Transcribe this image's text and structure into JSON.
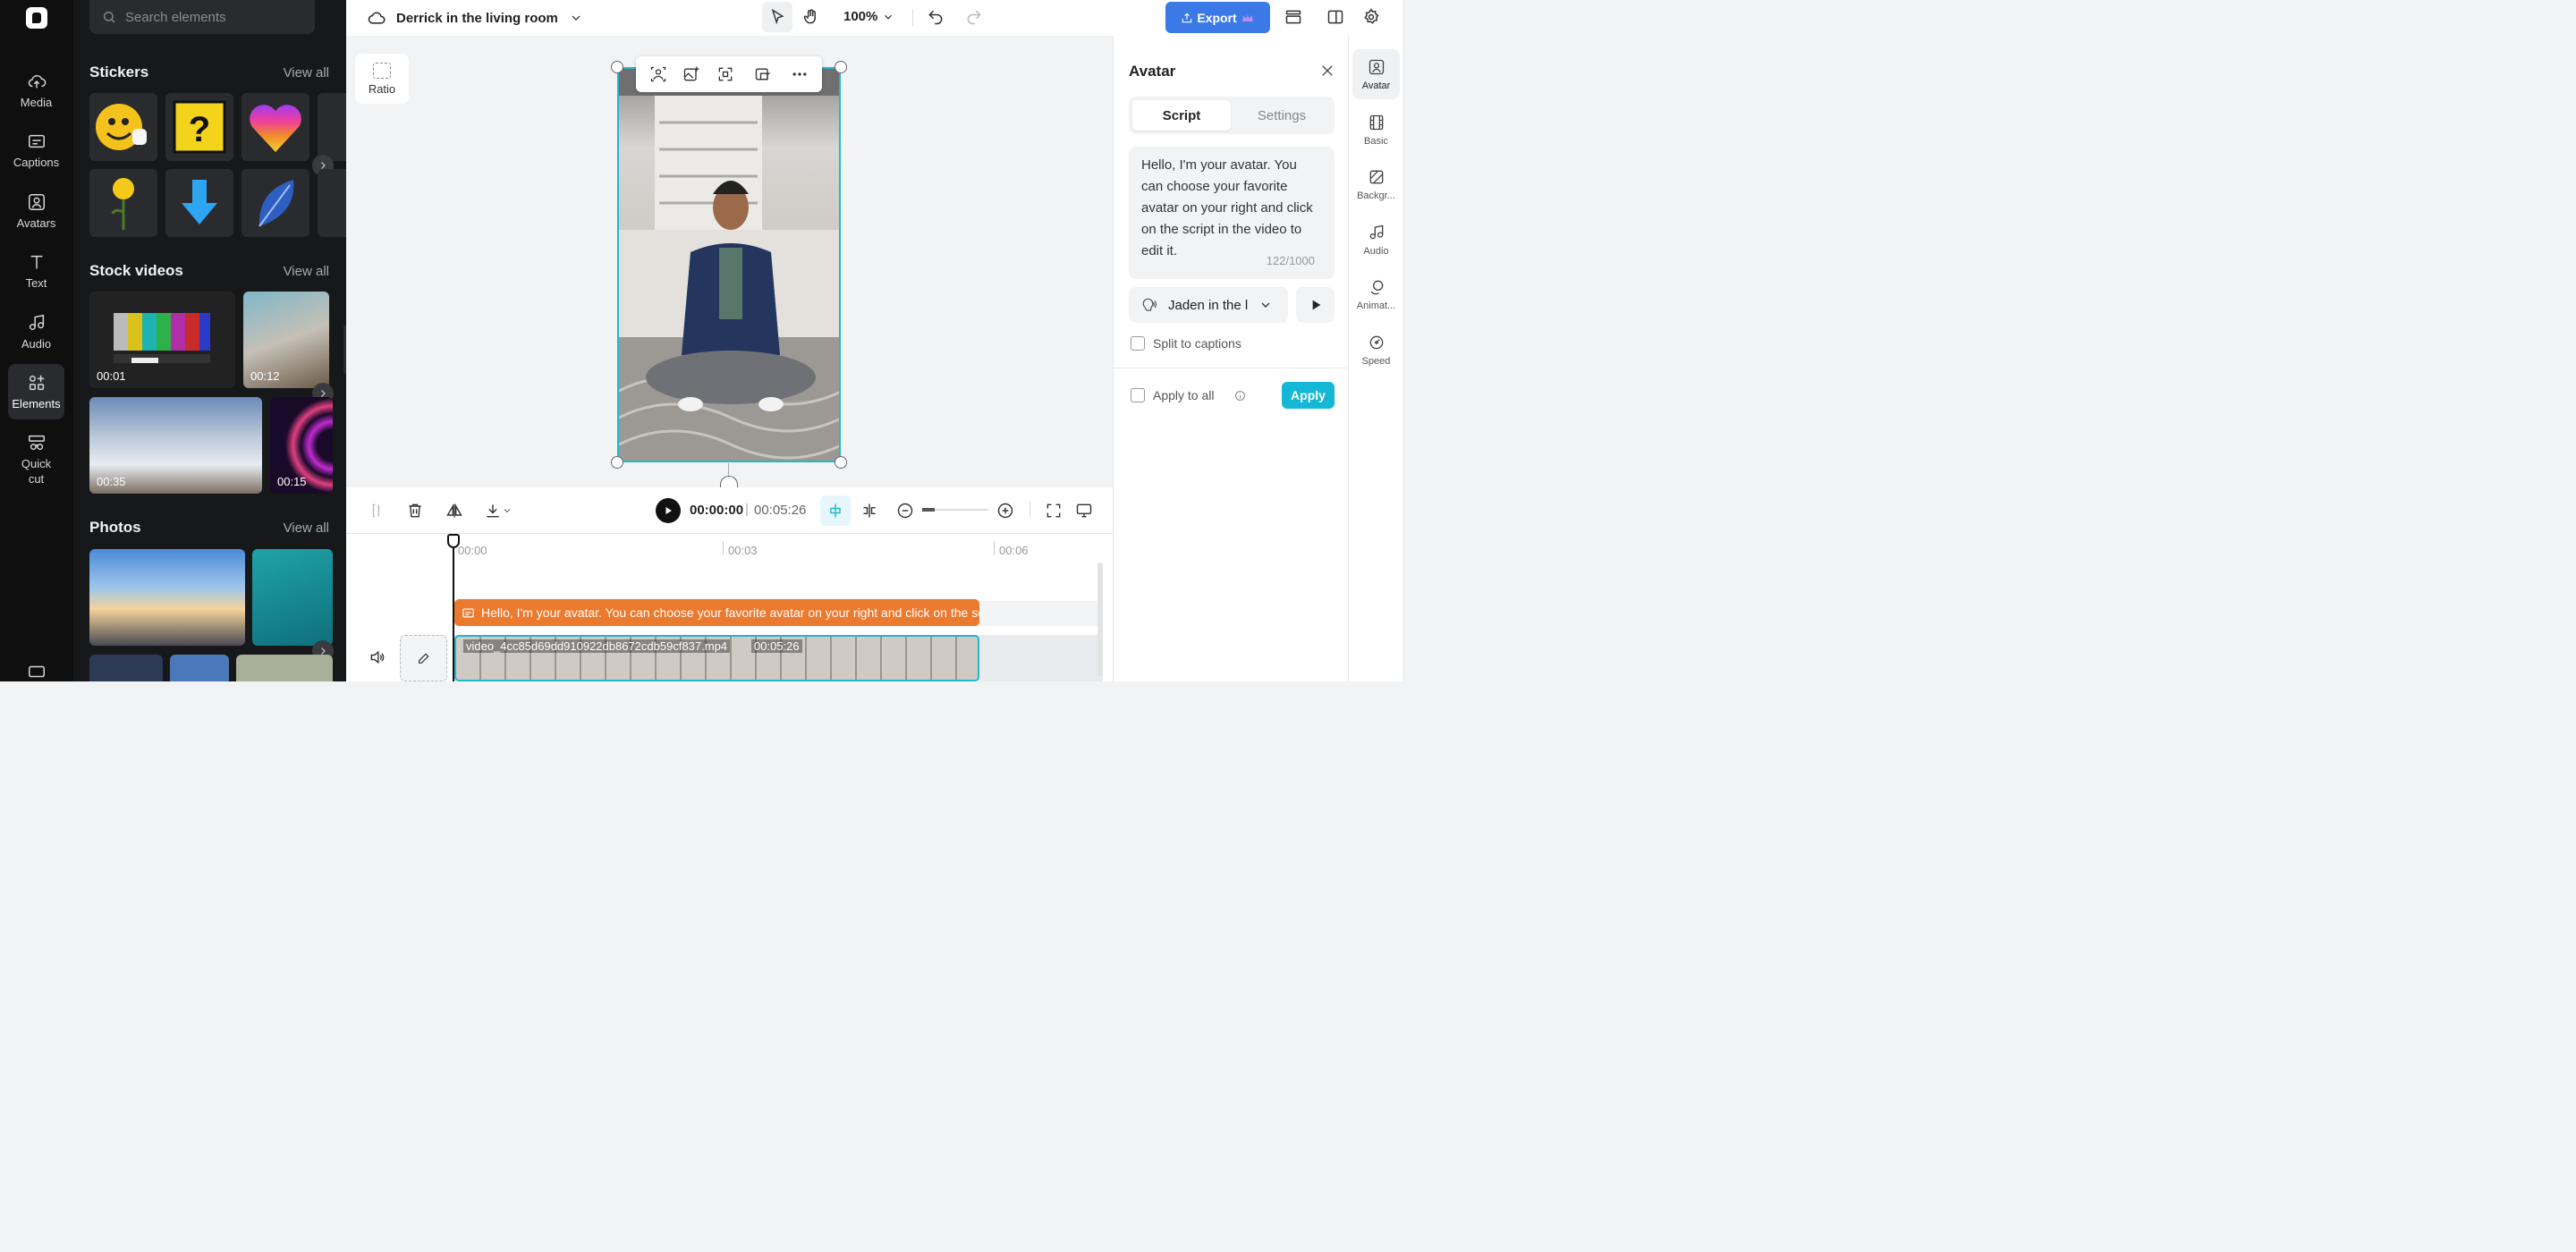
{
  "leftnav": {
    "items": [
      {
        "label": "Media",
        "icon": "cloud-upload-icon"
      },
      {
        "label": "Captions",
        "icon": "captions-icon"
      },
      {
        "label": "Avatars",
        "icon": "avatar-icon"
      },
      {
        "label": "Text",
        "icon": "text-icon"
      },
      {
        "label": "Audio",
        "icon": "music-note-icon"
      },
      {
        "label": "Elements",
        "icon": "elements-icon",
        "active": true
      },
      {
        "label": "Quick cut",
        "icon": "quick-cut-icon"
      }
    ]
  },
  "panel": {
    "search_placeholder": "Search elements",
    "stickers": {
      "title": "Stickers",
      "view_all": "View all"
    },
    "stock_videos": {
      "title": "Stock videos",
      "view_all": "View all",
      "durations": [
        "00:01",
        "00:12",
        "00:35",
        "00:15"
      ]
    },
    "photos": {
      "title": "Photos",
      "view_all": "View all"
    }
  },
  "topbar": {
    "project_name": "Derrick in the living room",
    "zoom": "100%",
    "export_label": "Export"
  },
  "canvas": {
    "ratio_label": "Ratio"
  },
  "avatar_panel": {
    "title": "Avatar",
    "tabs": [
      "Script",
      "Settings"
    ],
    "script_text": "Hello, I'm your avatar. You can choose your favorite avatar on your right and click on the script in the video to edit it.",
    "counter": "122/1000",
    "voice": "Jaden in the l",
    "split_captions": "Split to captions",
    "apply_all": "Apply to all",
    "apply": "Apply"
  },
  "right_strip": {
    "items": [
      {
        "label": "Avatar",
        "icon": "avatar-icon",
        "active": true
      },
      {
        "label": "Basic",
        "icon": "film-icon"
      },
      {
        "label": "Backgr...",
        "icon": "background-icon"
      },
      {
        "label": "Audio",
        "icon": "music-note-icon"
      },
      {
        "label": "Animat...",
        "icon": "animation-icon"
      },
      {
        "label": "Speed",
        "icon": "speed-icon"
      }
    ]
  },
  "timeline": {
    "current_time": "00:00:00",
    "total_time": "00:05:26",
    "ticks": [
      "00:00",
      "00:03",
      "00:06"
    ],
    "caption_text": "Hello, I'm your avatar. You can choose your favorite avatar on your right and click on the scr",
    "video_file": "video_4cc85d69dd910922db8672cdb59cf837.mp4",
    "video_duration": "00:05:26"
  },
  "colors": {
    "accent": "#21b8cc",
    "export": "#3b7ae6",
    "caption": "#ec7a2e",
    "apply": "#14b8d6"
  }
}
